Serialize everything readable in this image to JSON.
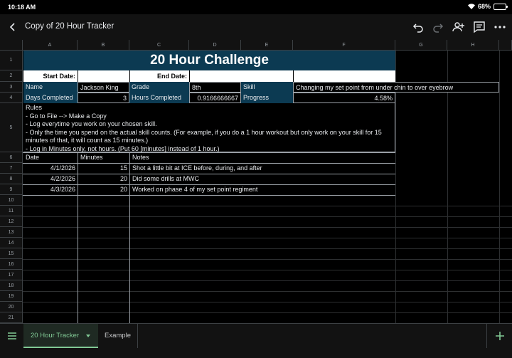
{
  "status": {
    "time": "10:18 AM",
    "battery": "68%",
    "battery_level": 0.68
  },
  "appbar": {
    "title": "Copy of 20 Hour Tracker"
  },
  "columns": [
    "A",
    "B",
    "C",
    "D",
    "E",
    "F",
    "G",
    "H"
  ],
  "rows": [
    "1",
    "2",
    "3",
    "4",
    "5",
    "6",
    "7",
    "8",
    "9",
    "10",
    "11",
    "12",
    "13",
    "14",
    "15",
    "16",
    "17",
    "18",
    "19",
    "20",
    "21"
  ],
  "sheet": {
    "title": "20 Hour Challenge",
    "start_date_label": "Start Date:",
    "end_date_label": "End Date:",
    "name_label": "Name",
    "name_value": "Jackson King",
    "grade_label": "Grade",
    "grade_value": "8th",
    "skill_label": "Skill",
    "skill_value": "Changing my set point from under chin to over eyebrow",
    "days_label": "Days Completed",
    "days_value": "3",
    "hours_label": "Hours Completed",
    "hours_value": "0.9166666667",
    "progress_label": "Progress",
    "progress_value": "4.58%",
    "rules": [
      "Rules",
      "- Go to File --> Make a Copy",
      "- Log everytime you work on your chosen skill.",
      "- Only the time you spend on the actual skill counts. (For example, if you do a 1 hour workout but only work on your skill for 15 minutes of that, it will count as 15 minutes.)",
      "- Log in Minutes only, not hours. (Put 60 [minutes] instead of 1 hour.)"
    ],
    "log_headers": {
      "date": "Date",
      "minutes": "Minutes",
      "notes": "Notes"
    },
    "log": [
      {
        "date": "4/1/2026",
        "minutes": "15",
        "notes": "Shot a little bit at ICE before, during, and after"
      },
      {
        "date": "4/2/2026",
        "minutes": "20",
        "notes": "Did some drills at MWC"
      },
      {
        "date": "4/3/2026",
        "minutes": "20",
        "notes": "Worked on phase 4 of my set point regiment"
      }
    ]
  },
  "tabs": {
    "active": "20 Hour Tracker",
    "other": "Example"
  }
}
